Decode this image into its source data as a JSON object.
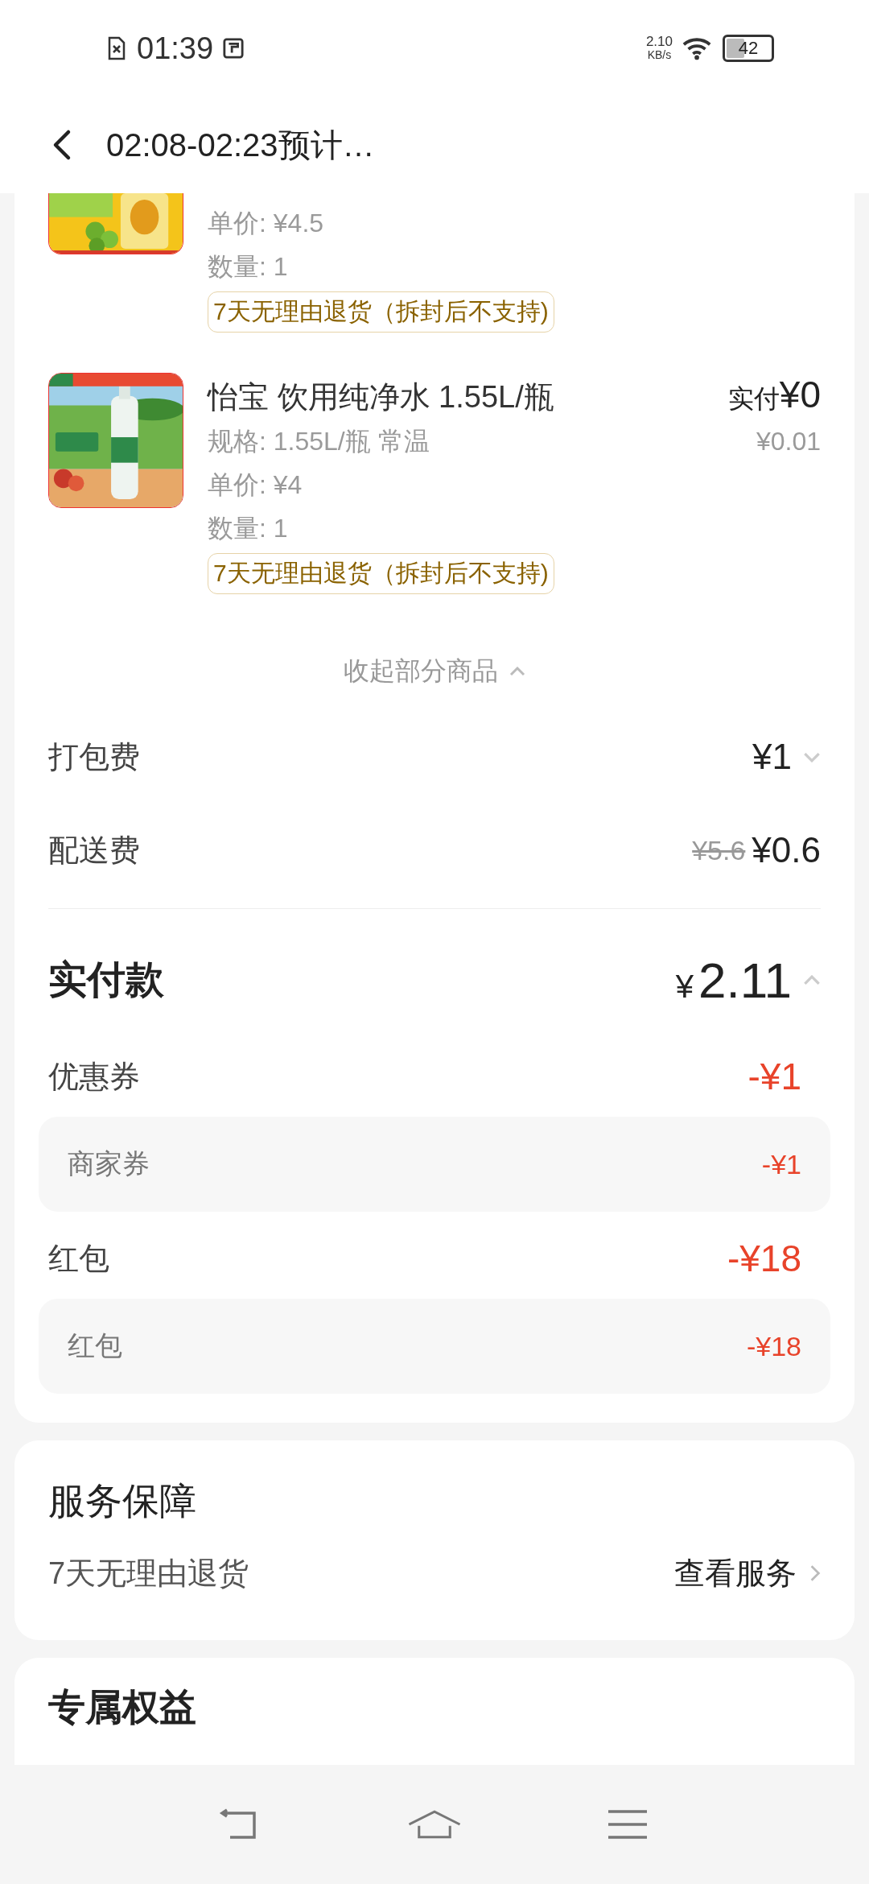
{
  "status_bar": {
    "time": "01:39",
    "net_speed": "2.10",
    "net_unit": "KB/s",
    "battery": "42"
  },
  "header": {
    "title": "02:08-02:23预计…"
  },
  "items": [
    {
      "unit_price": "单价: ¥4.5",
      "quantity": "数量: 1",
      "tag": "7天无理由退货（拆封后不支持)"
    },
    {
      "name": "怡宝 饮用纯净水 1.55L/瓶",
      "spec": "规格: 1.55L/瓶 常温",
      "unit_price": "单价: ¥4",
      "quantity": "数量: 1",
      "tag": "7天无理由退货（拆封后不支持)",
      "paid_label": "实付",
      "paid_amount": "¥0",
      "original_price": "¥0.01"
    }
  ],
  "collapse": {
    "label": "收起部分商品",
    "expanded": true
  },
  "fees": [
    {
      "kind": "toggle",
      "label": "打包费",
      "amount": "¥1",
      "expanded": false
    },
    {
      "kind": "discounted",
      "label": "配送费",
      "original": "¥5.6",
      "amount": "¥0.6"
    }
  ],
  "total": {
    "label": "实付款",
    "currency": "¥",
    "amount": "2.11",
    "expanded": true
  },
  "discounts": [
    {
      "label": "优惠券",
      "amount": "-¥1",
      "details": [
        {
          "label": "商家券",
          "amount": "-¥1"
        }
      ]
    },
    {
      "label": "红包",
      "amount": "-¥18",
      "details": [
        {
          "label": "红包",
          "amount": "-¥18"
        }
      ]
    }
  ],
  "service": {
    "title": "服务保障",
    "item": "7天无理由退货",
    "link": "查看服务"
  },
  "benefits": {
    "title": "专属权益"
  }
}
